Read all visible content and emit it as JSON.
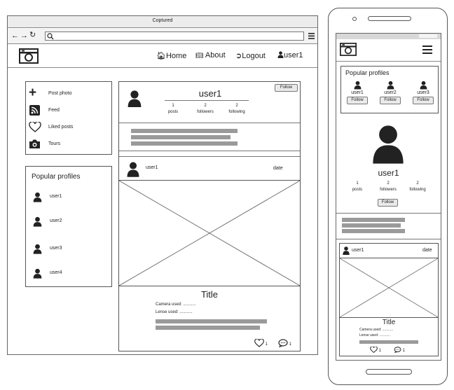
{
  "browser": {
    "title": "Coptured",
    "nav_icons": [
      "back-arrow-icon",
      "forward-arrow-icon",
      "reload-icon",
      "search-icon",
      "hamburger-menu-icon"
    ]
  },
  "desktop": {
    "nav": {
      "home": "Home",
      "about": "About",
      "logout": "Logout",
      "user": "user1"
    },
    "menu": [
      "Post photo",
      "Feed",
      "Liked posts",
      "Tours"
    ],
    "popular": {
      "title": "Popular profiles",
      "users": [
        "user1",
        "user2",
        "user3",
        "user4"
      ]
    },
    "profile": {
      "name": "user1",
      "follow_label": "Follow",
      "stats": [
        {
          "num": "1",
          "label": "posts"
        },
        {
          "num": "2",
          "label": "followers"
        },
        {
          "num": "2",
          "label": "following"
        }
      ]
    },
    "post": {
      "user": "user1",
      "date": "date",
      "title": "Title",
      "camera": "Camera used: ...........",
      "lense": "Lense used: ...........",
      "likes": "1",
      "comments": "1"
    }
  },
  "mobile": {
    "popular": {
      "title": "Popular profiles",
      "users": [
        {
          "name": "user1",
          "follow": "Follow"
        },
        {
          "name": "user2",
          "follow": "Follow"
        },
        {
          "name": "user3",
          "follow": "Follow"
        }
      ]
    },
    "profile": {
      "name": "user1",
      "follow_label": "Follow",
      "stats": [
        {
          "num": "1",
          "label": "posts"
        },
        {
          "num": "2",
          "label": "followers"
        },
        {
          "num": "2",
          "label": "following"
        }
      ]
    },
    "post": {
      "user": "user1",
      "date": "date",
      "title": "Title",
      "camera": "Camera used: ...........",
      "lense": "Lense used: ...........",
      "likes": "1",
      "comments": "1"
    }
  },
  "colors": {
    "border": "#555555",
    "placeholder_bar": "#9a9a9a",
    "icon": "#222222"
  }
}
